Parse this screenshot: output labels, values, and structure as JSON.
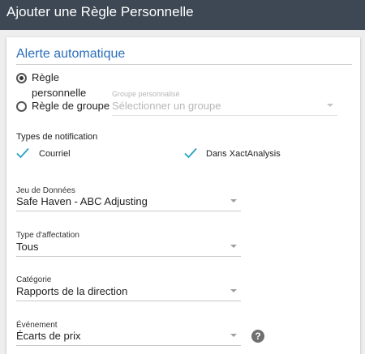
{
  "header": {
    "title": "Ajouter une Règle Personnelle"
  },
  "section": {
    "title": "Alerte automatique"
  },
  "rule_type": {
    "option_personal_line1": "Règle",
    "option_personal_line2": "personnelle",
    "option_group": "Règle de groupe",
    "group_field_label": "Groupe personnalisé",
    "group_field_placeholder": "Sélectionner un groupe"
  },
  "notifications": {
    "title": "Types de notification",
    "email": "Courriel",
    "xact": "Dans XactAnalysis"
  },
  "dataset": {
    "label": "Jeu de Données",
    "value": "Safe Haven - ABC Adjusting"
  },
  "assignment": {
    "label": "Type d'affectation",
    "value": "Tous"
  },
  "category": {
    "label": "Catégorie",
    "value": "Rapports de la direction"
  },
  "event": {
    "label": "Événement",
    "value": "Écarts de prix",
    "help": "?"
  },
  "colors": {
    "header_bg": "#3d4854",
    "accent": "#2a6ebb",
    "check": "#26a0c0"
  }
}
